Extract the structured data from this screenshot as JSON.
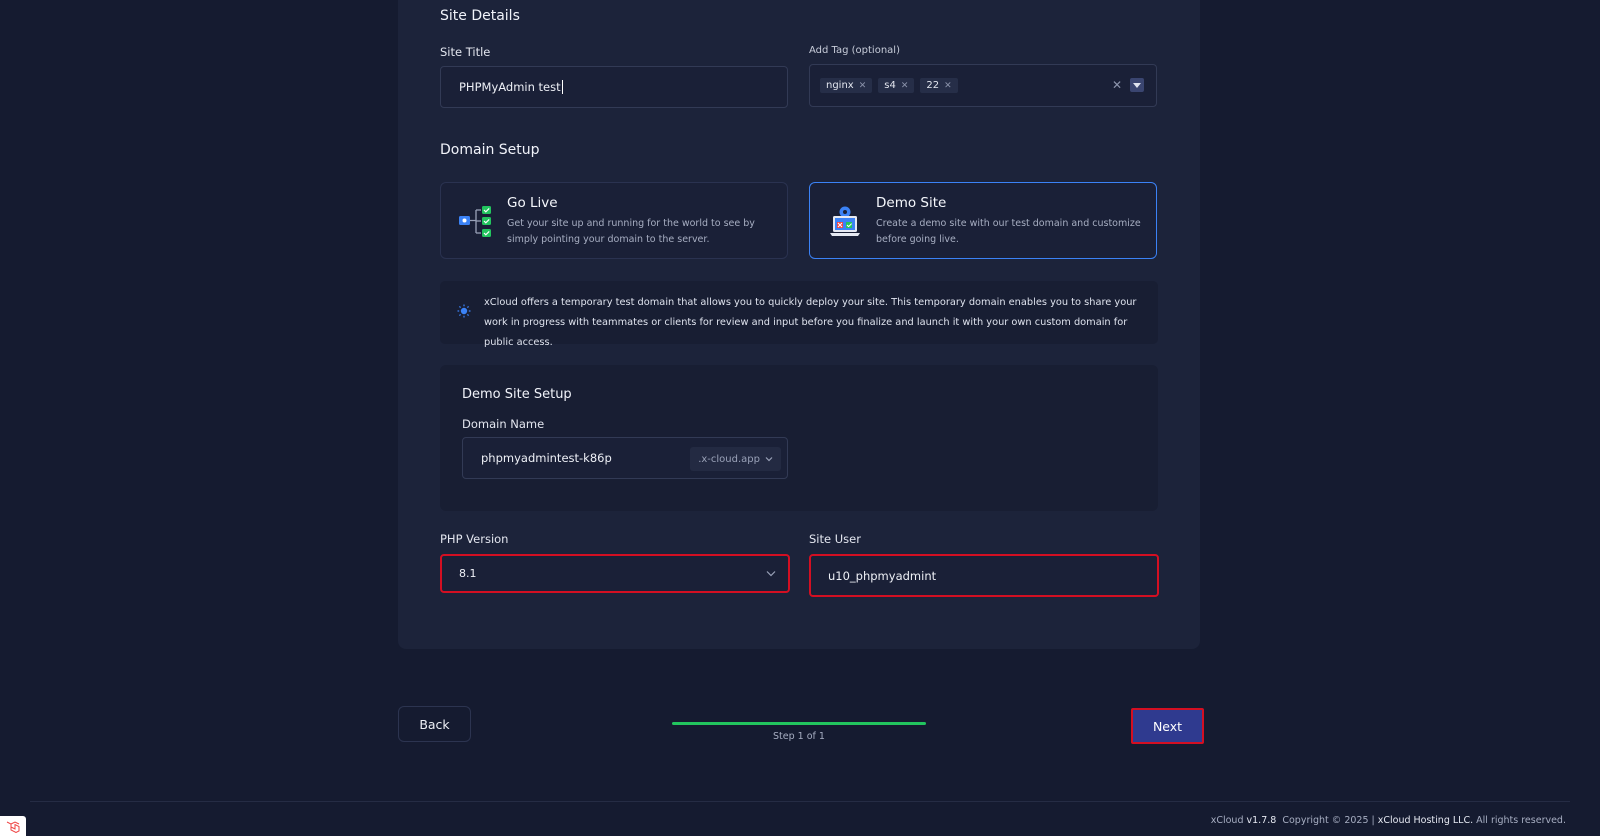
{
  "site_details": {
    "heading": "Site Details",
    "site_title_label": "Site Title",
    "site_title_value": "PHPMyAdmin test",
    "tag_label": "Add Tag (optional)",
    "tags": [
      "nginx",
      "s4",
      "22"
    ]
  },
  "domain_setup": {
    "heading": "Domain Setup",
    "options": [
      {
        "title": "Go Live",
        "description": "Get your site up and running for the world to see by simply pointing your domain to the server.",
        "selected": false
      },
      {
        "title": "Demo Site",
        "description": "Create a demo site with our test domain and customize before going live.",
        "selected": true
      }
    ],
    "info_text": "xCloud offers a temporary test domain that allows you to quickly deploy your site. This temporary domain enables you to share your work in progress with teammates or clients for review and input before you finalize and launch it with your own custom domain for public access."
  },
  "demo_site_setup": {
    "heading": "Demo Site Setup",
    "domain_label": "Domain Name",
    "domain_value": "phpmyadmintest-k86p",
    "domain_suffix": ".x-cloud.app"
  },
  "php_version": {
    "label": "PHP Version",
    "value": "8.1"
  },
  "site_user": {
    "label": "Site User",
    "value": "u10_phpmyadmint"
  },
  "nav": {
    "back_label": "Back",
    "next_label": "Next",
    "step_text": "Step 1 of 1",
    "progress": 1.0
  },
  "footer": {
    "brand": "xCloud",
    "version": "v1.7.8",
    "copyright_prefix": "Copyright © 2025 |",
    "company": "xCloud Hosting LLC.",
    "rights": "All rights reserved."
  },
  "colors": {
    "accent": "#3b82f6",
    "progress": "#22c55e",
    "highlight": "#d30f22",
    "next_button": "#2f3a8f"
  }
}
